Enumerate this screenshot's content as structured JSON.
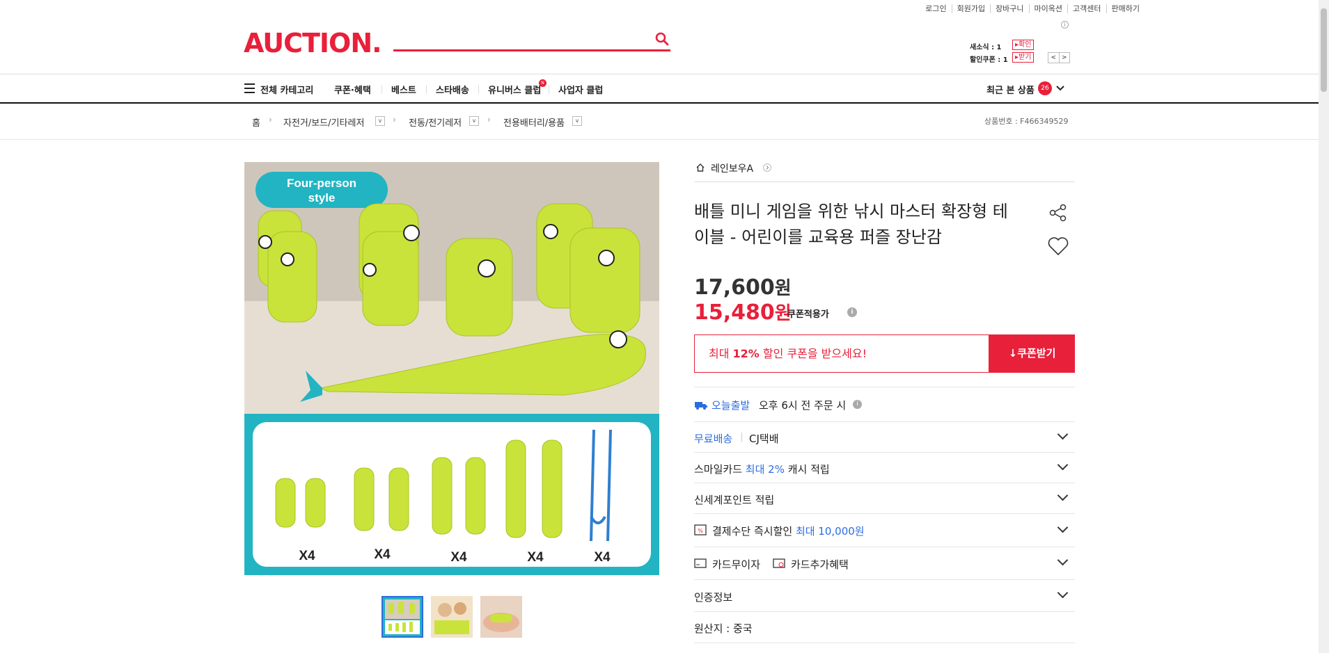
{
  "util_links": [
    "로그인",
    "회원가입",
    "장바구니",
    "마이옥션",
    "고객센터",
    "판매하기"
  ],
  "logo": "AUCTION.",
  "mini": {
    "news_label": "새소식 : 1",
    "news_btn": "▸확인",
    "coupon_label": "할인쿠폰 : 1",
    "coupon_btn": "▸받기"
  },
  "nav": {
    "all_categories": "전체 카테고리",
    "items": [
      "쿠폰·혜택",
      "베스트",
      "스타배송",
      "유니버스 클럽",
      "사업자 클럽"
    ],
    "new_badge": "N",
    "recent": "최근 본 상품",
    "recent_count": "26"
  },
  "breadcrumb": {
    "home": "홈",
    "items": [
      "자전거/보드/기타레저",
      "전동/전기레저",
      "전용배터리/용품"
    ],
    "product_no": "상품번호 : F466349529"
  },
  "image": {
    "badge_line1": "Four-person",
    "badge_line2": "style",
    "counts": [
      "X4",
      "X4",
      "X4",
      "X4",
      "X4"
    ]
  },
  "product": {
    "seller": "레인보우A",
    "title": "배틀 미니 게임을 위한 낚시 마스터 확장형 테이블 - 어린이를 교육용 퍼즐 장난감",
    "price": "17,600",
    "price_unit": "원",
    "sale_price": "15,480",
    "sale_unit": "원",
    "coupon_note": "쿠폰적용가",
    "coupon_pre": "최대 ",
    "coupon_pct": "12%",
    "coupon_post": " 할인 쿠폰을 받으세요!",
    "coupon_btn": "쿠폰받기"
  },
  "rows": {
    "today": "오늘출발",
    "today_desc": "오후 6시 전 주문 시",
    "free_ship": "무료배송",
    "courier": "CJ택배",
    "smile_pre": "스마일카드 ",
    "smile_hi": "최대 2%",
    "smile_post": " 캐시 적립",
    "ssg": "신세계포인트 적립",
    "pay_pre": "결제수단 즉시할인 ",
    "pay_hi": "최대 10,000원",
    "card1": "카드무이자",
    "card2": "카드추가혜택",
    "cert": "인증정보",
    "origin": "원산지 : 중국"
  },
  "colors": {
    "brand": "#e8203a",
    "accent": "#2d6cdf"
  }
}
